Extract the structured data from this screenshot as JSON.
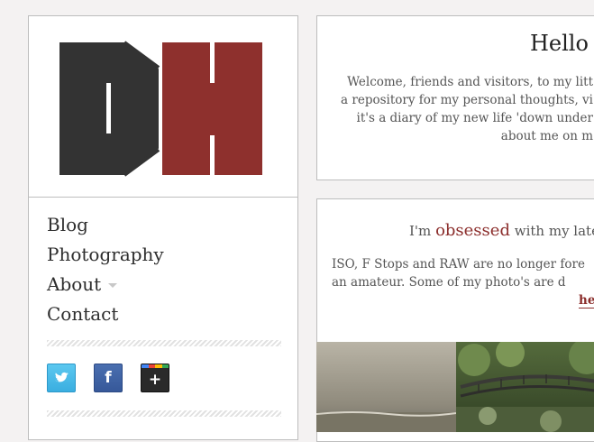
{
  "brand": {
    "logo_letters": "DH",
    "colors": {
      "dark": "#333333",
      "red": "#8e302d"
    }
  },
  "nav": {
    "items": [
      {
        "label": "Blog",
        "has_submenu": false
      },
      {
        "label": "Photography",
        "has_submenu": false
      },
      {
        "label": "About",
        "has_submenu": true
      },
      {
        "label": "Contact",
        "has_submenu": false
      }
    ]
  },
  "social": {
    "icons": [
      "twitter-icon",
      "facebook-icon",
      "google-plus-icon"
    ],
    "facebook_glyph": "f",
    "google_plus_glyph": "+"
  },
  "hello": {
    "title": "Hello T",
    "lines": [
      "Welcome, friends and visitors, to my litt",
      "a repository for my personal thoughts, vi",
      "it's a diary of my new life 'down under",
      "about me on m"
    ]
  },
  "obsessed": {
    "intro": "I'm",
    "highlight": "obsessed",
    "rest": "with my late",
    "lines": [
      "ISO, F Stops and RAW are no longer fore",
      "an amateur. Some of my photo's are d"
    ],
    "link_text": "he"
  },
  "accent_color": "#8b2d2b"
}
